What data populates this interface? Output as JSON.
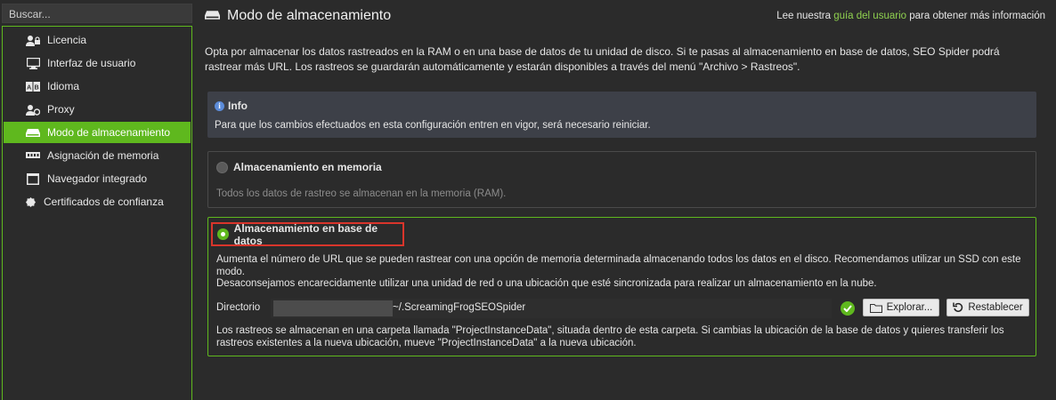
{
  "search": {
    "placeholder": "Buscar..."
  },
  "sidebar": {
    "items": [
      {
        "label": "Licencia",
        "icon": "license-icon"
      },
      {
        "label": "Interfaz de usuario",
        "icon": "monitor-icon"
      },
      {
        "label": "Idioma",
        "icon": "language-icon"
      },
      {
        "label": "Proxy",
        "icon": "proxy-icon"
      },
      {
        "label": "Modo de almacenamiento",
        "icon": "storage-icon",
        "active": true
      },
      {
        "label": "Asignación de memoria",
        "icon": "memory-icon"
      },
      {
        "label": "Navegador integrado",
        "icon": "browser-icon"
      },
      {
        "label": "Certificados de confianza",
        "icon": "certificate-icon"
      }
    ]
  },
  "header": {
    "title": "Modo de almacenamiento",
    "guide_prefix": "Lee nuestra ",
    "guide_link": "guía del usuario",
    "guide_suffix": " para obtener más información"
  },
  "intro": "Opta por almacenar los datos rastreados en la RAM o en una base de datos de tu unidad de disco. Si te pasas al almacenamiento en base de datos, SEO Spider podrá rastrear más URL. Los rastreos se guardarán automáticamente y estarán disponibles a través del menú \"Archivo > Rastreos\".",
  "info": {
    "title": "Info",
    "body": "Para que los cambios efectuados en esta configuración entren en vigor, será necesario reiniciar."
  },
  "memory_option": {
    "label": "Almacenamiento en memoria",
    "description": "Todos los datos de rastreo se almacenan en la memoria (RAM).",
    "selected": false
  },
  "database_option": {
    "label": "Almacenamiento en base de datos",
    "selected": true,
    "description_1": "Aumenta el número de URL que se pueden rastrear con una opción de memoria determinada almacenando todos los datos en el disco. Recomendamos utilizar un SSD con este modo.",
    "description_2": "Desaconsejamos encarecidamente utilizar una unidad de red o una ubicación que esté sincronizada para realizar un almacenamiento en la nube.",
    "directory_label": "Directorio",
    "directory_value": "~/.ScreamingFrogSEOSpider",
    "browse_label": "Explorar...",
    "reset_label": "Restablecer",
    "note": "Los rastreos se almacenan en una carpeta llamada \"ProjectInstanceData\", situada dentro de esta carpeta. Si cambias la ubicación de la base de datos y quieres transferir los rastreos existentes a la nueva ubicación, mueve \"ProjectInstanceData\" a la nueva ubicación."
  },
  "colors": {
    "accent": "#5fb81e",
    "highlight": "#d9352b",
    "background": "#2b2b2b",
    "info_bg": "#3d4048"
  }
}
